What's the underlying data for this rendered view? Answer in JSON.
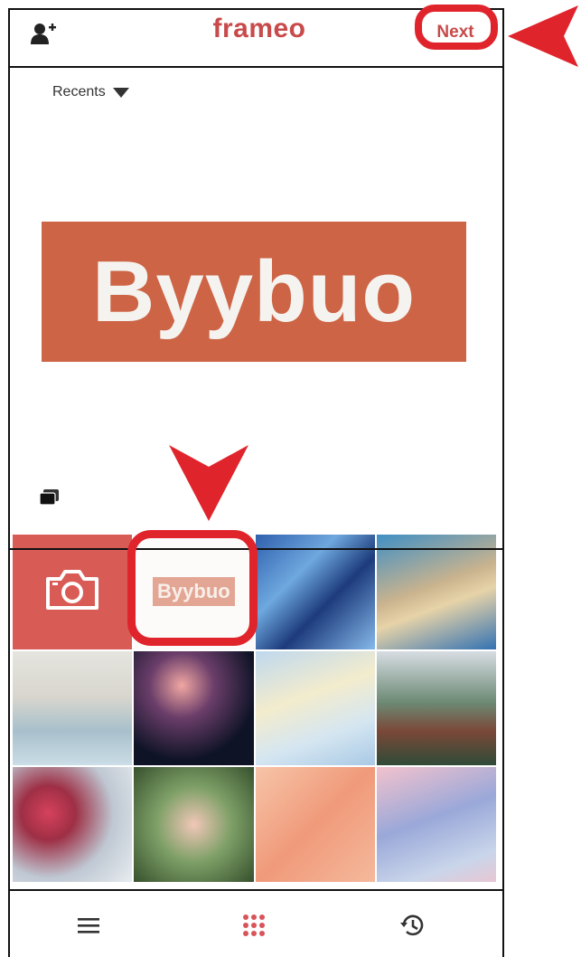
{
  "header": {
    "logo": "frameo",
    "next_label": "Next"
  },
  "album": {
    "selector_label": "Recents"
  },
  "preview": {
    "text": "Byybuo"
  },
  "grid": {
    "thumb_text": "Byybuo"
  },
  "colors": {
    "brand": "#c84a4a",
    "annotation": "#e0242c",
    "preview_bg": "#cd6446",
    "camera_tile": "#d95b55"
  },
  "icons": [
    "add-friend-icon",
    "dropdown-arrow-icon",
    "multi-select-icon",
    "camera-icon",
    "menu-icon",
    "grid-icon",
    "history-icon"
  ]
}
